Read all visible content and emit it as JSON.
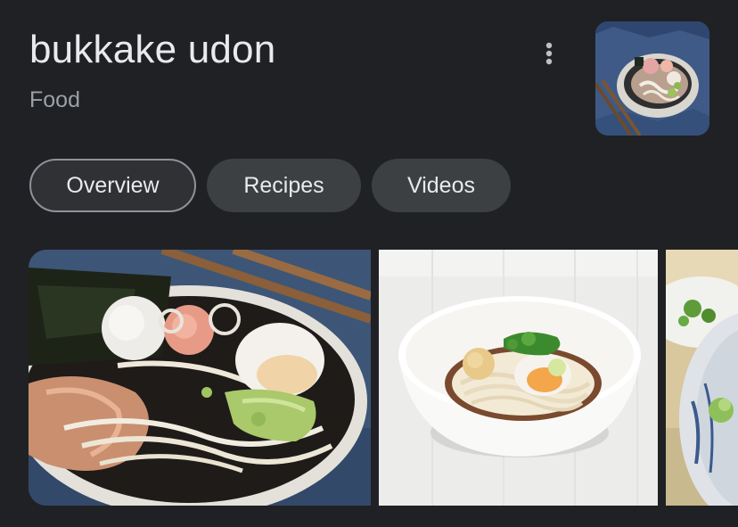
{
  "entity": {
    "title": "bukkake udon",
    "subtitle": "Food"
  },
  "header": {
    "more_icon": "more-vert-icon",
    "thumbnail_icon": "udon-bowl-thumbnail"
  },
  "tabs": [
    {
      "label": "Overview",
      "active": true
    },
    {
      "label": "Recipes",
      "active": false
    },
    {
      "label": "Videos",
      "active": false
    }
  ],
  "gallery": {
    "images": [
      {
        "subject": "udon bowl with nori, egg and bonito flakes"
      },
      {
        "subject": "udon in white bowl with egg and green onion"
      },
      {
        "subject": "udon bowl with green onion (partially visible)"
      }
    ]
  },
  "colors": {
    "background": "#202124",
    "chip_background": "#3c4043",
    "active_chip_border": "#8e9298",
    "text_primary": "#e8eaed",
    "text_secondary": "#9aa0a6"
  }
}
